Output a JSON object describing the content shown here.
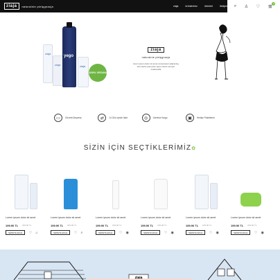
{
  "header": {
    "logo": "ziaja",
    "tagline": "naturalnie pielęgnacja",
    "nav": [
      "ziaja",
      "ürünlerimiz",
      "ürünleri",
      "iletişim"
    ],
    "cart_count": "0"
  },
  "hero": {
    "product_label": "yego",
    "badge": "100% VEGAN",
    "logo": "ziaja",
    "subtitle": "naturalnie pielęgnacja",
    "description": "lorem ipsum dolor sit amet consectetur adipiscing elit mauris quis justo eget mauris semper malesuada"
  },
  "features": [
    {
      "icon": "wallet-icon",
      "text": "Güvenli Alışveriş"
    },
    {
      "icon": "truck-icon",
      "text": "14 Gün içinde İade"
    },
    {
      "icon": "balloon-icon",
      "text": "Ücretsiz Kargo"
    },
    {
      "icon": "gift-icon",
      "text": "Hediye Paketleme"
    }
  ],
  "section": {
    "title": "SİZİN İÇİN SEÇTİKLERİMİZ"
  },
  "products": [
    {
      "name": "Lorem ipsum dolor sit amet",
      "price": "199.90 TL",
      "old": "249.90 TL",
      "button": "SEPETE EKLE",
      "kind": "tube"
    },
    {
      "name": "Lorem ipsum dolor sit amet",
      "price": "199.90 TL",
      "old": "249.90 TL",
      "button": "SEPETE EKLE",
      "kind": "blue"
    },
    {
      "name": "Lorem ipsum dolor sit amet",
      "price": "199.90 TL",
      "old": "249.90 TL",
      "button": "SEPETE EKLE",
      "kind": "spray"
    },
    {
      "name": "Lorem ipsum dolor sit amet",
      "price": "199.90 TL",
      "old": "249.90 TL",
      "button": "SEPETE EKLE",
      "kind": "white"
    },
    {
      "name": "Lorem ipsum dolor sit amet",
      "price": "199.90 TL",
      "old": "249.90 TL",
      "button": "SEPETE EKLE",
      "kind": "tube"
    },
    {
      "name": "Lorem ipsum dolor sit amet",
      "price": "199.90 TL",
      "old": "249.90 TL",
      "button": "SEPETE EKLE",
      "kind": "jar"
    }
  ],
  "banner": {
    "logo": "ziaja"
  }
}
